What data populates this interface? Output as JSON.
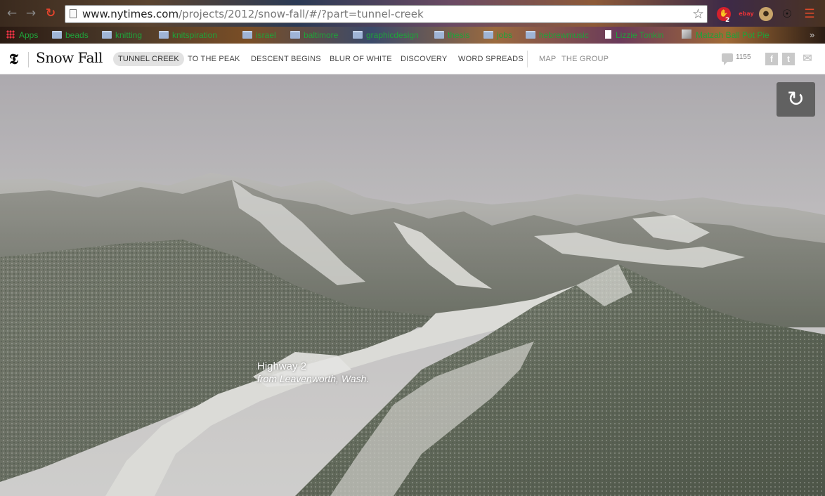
{
  "browser": {
    "url_host": "www.nytimes.com",
    "url_path": "/projects/2012/snow-fall/#/?part=tunnel-creek",
    "extension_badge": "2",
    "ebay_label": "ebay"
  },
  "bookmarks": [
    {
      "label": "Apps",
      "icon": "apps-grid-icon"
    },
    {
      "label": "beads",
      "icon": "folder-icon"
    },
    {
      "label": "knitting",
      "icon": "folder-icon"
    },
    {
      "label": "knitspiration",
      "icon": "folder-icon"
    },
    {
      "label": "israel",
      "icon": "folder-icon"
    },
    {
      "label": "baltimore",
      "icon": "folder-icon"
    },
    {
      "label": "graphicdesign",
      "icon": "folder-icon"
    },
    {
      "label": "thesis",
      "icon": "folder-icon"
    },
    {
      "label": "jobs",
      "icon": "folder-icon"
    },
    {
      "label": "hebrewmusic",
      "icon": "folder-icon"
    },
    {
      "label": "Lizzie Tonkin",
      "icon": "page-icon"
    },
    {
      "label": "Matzah Ball Pot Pie",
      "icon": "image-icon"
    }
  ],
  "site": {
    "logo": "𝕿",
    "title": "Snow Fall",
    "nav": [
      {
        "label": "TUNNEL CREEK",
        "active": true
      },
      {
        "label": "TO THE PEAK"
      },
      {
        "label": "DESCENT BEGINS"
      },
      {
        "label": "BLUR OF WHITE"
      },
      {
        "label": "DISCOVERY"
      },
      {
        "label": "WORD SPREADS"
      }
    ],
    "subnav": [
      "MAP",
      "THE GROUP"
    ],
    "comment_count": "1155"
  },
  "hero": {
    "caption_title": "Highway 2",
    "caption_subtitle": "from Leavenworth, Wash."
  },
  "colors": {
    "bookmark_text": "#1fa33a",
    "reload_icon": "#e0442c",
    "menu_icon": "#e04a2a"
  }
}
